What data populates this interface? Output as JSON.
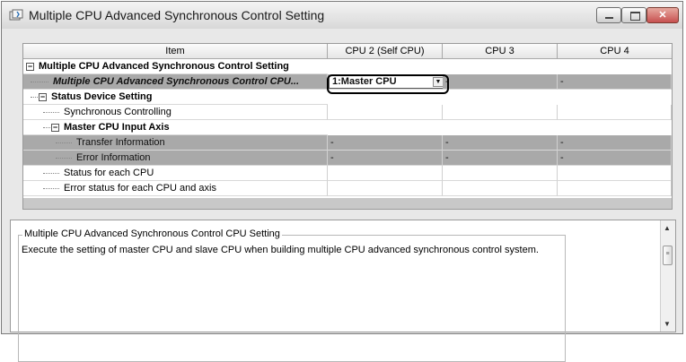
{
  "window": {
    "title": "Multiple CPU Advanced Synchronous Control Setting"
  },
  "grid": {
    "headers": [
      "Item",
      "CPU 2 (Self CPU)",
      "CPU 3",
      "CPU 4"
    ],
    "rows": [
      {
        "label": "Multiple CPU Advanced Synchronous Control Setting",
        "c2": "",
        "c3": "",
        "c4": ""
      },
      {
        "label": "Multiple CPU Advanced Synchronous Control CPU...",
        "c2": "1:Master CPU",
        "c3": "-",
        "c4": "-"
      },
      {
        "label": "Status Device Setting",
        "c2": "",
        "c3": "",
        "c4": ""
      },
      {
        "label": "Synchronous Controlling",
        "c2": "",
        "c3": "",
        "c4": ""
      },
      {
        "label": "Master CPU Input Axis",
        "c2": "",
        "c3": "",
        "c4": ""
      },
      {
        "label": "Transfer Information",
        "c2": "-",
        "c3": "-",
        "c4": "-"
      },
      {
        "label": "Error Information",
        "c2": "-",
        "c3": "-",
        "c4": "-"
      },
      {
        "label": "Status for each CPU",
        "c2": "",
        "c3": "",
        "c4": ""
      },
      {
        "label": "Error status for each CPU and axis",
        "c2": "",
        "c3": "",
        "c4": ""
      }
    ]
  },
  "description": {
    "title": "Multiple CPU Advanced Synchronous Control CPU Setting",
    "text": "Execute the setting of master CPU and slave CPU when building multiple CPU advanced synchronous control system."
  },
  "colors": {
    "gray_row": "#a9a9a9",
    "close_button": "#c75050"
  }
}
